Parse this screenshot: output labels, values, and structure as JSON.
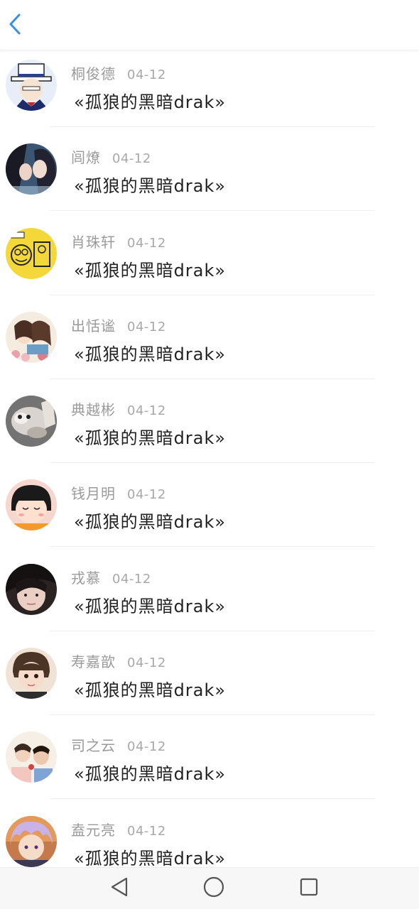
{
  "header": {
    "back_icon": "chevron-left-icon",
    "accent_color": "#3a8ee6"
  },
  "comments": [
    {
      "name": "桐俊德",
      "date": "04-12",
      "title": "«孤狼的黑暗drak»"
    },
    {
      "name": "闾燎",
      "date": "04-12",
      "title": "«孤狼的黑暗drak»"
    },
    {
      "name": "肖珠轩",
      "date": "04-12",
      "title": "«孤狼的黑暗drak»"
    },
    {
      "name": "出恬谧",
      "date": "04-12",
      "title": "«孤狼的黑暗drak»"
    },
    {
      "name": "典越彬",
      "date": "04-12",
      "title": "«孤狼的黑暗drak»"
    },
    {
      "name": "钱月明",
      "date": "04-12",
      "title": "«孤狼的黑暗drak»"
    },
    {
      "name": "戎慕",
      "date": "04-12",
      "title": "«孤狼的黑暗drak»"
    },
    {
      "name": "寿嘉歆",
      "date": "04-12",
      "title": "«孤狼的黑暗drak»"
    },
    {
      "name": "司之云",
      "date": "04-12",
      "title": "«孤狼的黑暗drak»"
    },
    {
      "name": "盍元亮",
      "date": "04-12",
      "title": "«孤狼的黑暗drak»"
    }
  ],
  "navbar": {
    "buttons": [
      "back-triangle-icon",
      "home-circle-icon",
      "recents-square-icon"
    ]
  }
}
